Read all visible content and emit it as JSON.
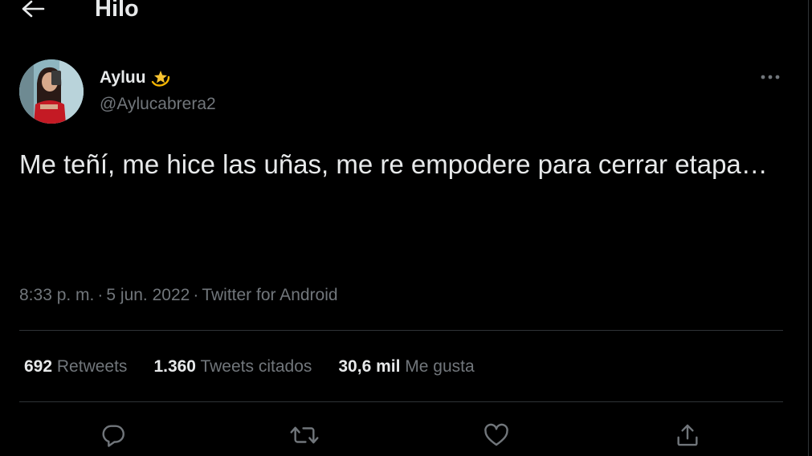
{
  "header": {
    "title": "Hilo",
    "back_icon": "arrow-left-icon"
  },
  "tweet": {
    "author": {
      "display_name": "Ayluu",
      "emoji_icon": "dizzy-star-emoji",
      "handle": "@Aylucabrera2"
    },
    "text": "Me teñí, me hice las uñas, me re empodere para cerrar etapa…",
    "time": "8:33 p. m.",
    "date": "5 jun. 2022",
    "source": "Twitter for Android",
    "separator": "·"
  },
  "stats": {
    "retweets": {
      "count": "692",
      "label": "Retweets"
    },
    "quotes": {
      "count": "1.360",
      "label": "Tweets citados"
    },
    "likes": {
      "count": "30,6 mil",
      "label": "Me gusta"
    }
  },
  "actions": [
    "reply-icon",
    "retweet-icon",
    "like-icon",
    "share-icon"
  ],
  "colors": {
    "background": "#000000",
    "text_primary": "#e7e9ea",
    "text_secondary": "#71767b",
    "divider": "#2f3336"
  }
}
